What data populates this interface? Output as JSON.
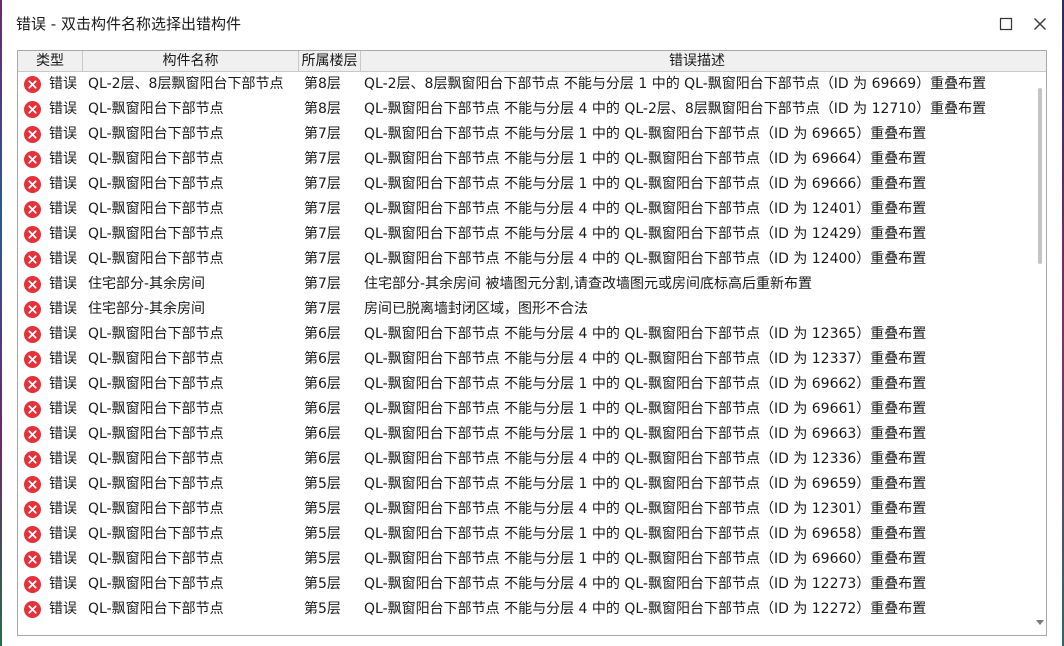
{
  "window": {
    "title": "错误 - 双击构件名称选择出错构件",
    "maximize_icon": "maximize-icon",
    "close_icon": "close-icon"
  },
  "table": {
    "columns": [
      "类型",
      "构件名称",
      "所属楼层",
      "错误描述"
    ],
    "rows": [
      {
        "type": "错误",
        "name": "QL-2层、8层飘窗阳台下部节点",
        "floor": "第8层",
        "desc": "QL-2层、8层飘窗阳台下部节点 不能与分层 1 中的 QL-飘窗阳台下部节点（ID 为 69669）重叠布置"
      },
      {
        "type": "错误",
        "name": "QL-飘窗阳台下部节点",
        "floor": "第8层",
        "desc": "QL-飘窗阳台下部节点 不能与分层 4 中的 QL-2层、8层飘窗阳台下部节点（ID 为 12710）重叠布置"
      },
      {
        "type": "错误",
        "name": "QL-飘窗阳台下部节点",
        "floor": "第7层",
        "desc": "QL-飘窗阳台下部节点 不能与分层 1 中的 QL-飘窗阳台下部节点（ID 为 69665）重叠布置"
      },
      {
        "type": "错误",
        "name": "QL-飘窗阳台下部节点",
        "floor": "第7层",
        "desc": "QL-飘窗阳台下部节点 不能与分层 1 中的 QL-飘窗阳台下部节点（ID 为 69664）重叠布置"
      },
      {
        "type": "错误",
        "name": "QL-飘窗阳台下部节点",
        "floor": "第7层",
        "desc": "QL-飘窗阳台下部节点 不能与分层 1 中的 QL-飘窗阳台下部节点（ID 为 69666）重叠布置"
      },
      {
        "type": "错误",
        "name": "QL-飘窗阳台下部节点",
        "floor": "第7层",
        "desc": "QL-飘窗阳台下部节点 不能与分层 4 中的 QL-飘窗阳台下部节点（ID 为 12401）重叠布置"
      },
      {
        "type": "错误",
        "name": "QL-飘窗阳台下部节点",
        "floor": "第7层",
        "desc": "QL-飘窗阳台下部节点 不能与分层 4 中的 QL-飘窗阳台下部节点（ID 为 12429）重叠布置"
      },
      {
        "type": "错误",
        "name": "QL-飘窗阳台下部节点",
        "floor": "第7层",
        "desc": "QL-飘窗阳台下部节点 不能与分层 4 中的 QL-飘窗阳台下部节点（ID 为 12400）重叠布置"
      },
      {
        "type": "错误",
        "name": "住宅部分-其余房间",
        "floor": "第7层",
        "desc": "住宅部分-其余房间 被墙图元分割,请查改墙图元或房间底标高后重新布置"
      },
      {
        "type": "错误",
        "name": "住宅部分-其余房间",
        "floor": "第7层",
        "desc": "房间已脱离墙封闭区域，图形不合法"
      },
      {
        "type": "错误",
        "name": "QL-飘窗阳台下部节点",
        "floor": "第6层",
        "desc": "QL-飘窗阳台下部节点 不能与分层 4 中的 QL-飘窗阳台下部节点（ID 为 12365）重叠布置"
      },
      {
        "type": "错误",
        "name": "QL-飘窗阳台下部节点",
        "floor": "第6层",
        "desc": "QL-飘窗阳台下部节点 不能与分层 4 中的 QL-飘窗阳台下部节点（ID 为 12337）重叠布置"
      },
      {
        "type": "错误",
        "name": "QL-飘窗阳台下部节点",
        "floor": "第6层",
        "desc": "QL-飘窗阳台下部节点 不能与分层 1 中的 QL-飘窗阳台下部节点（ID 为 69662）重叠布置"
      },
      {
        "type": "错误",
        "name": "QL-飘窗阳台下部节点",
        "floor": "第6层",
        "desc": "QL-飘窗阳台下部节点 不能与分层 1 中的 QL-飘窗阳台下部节点（ID 为 69661）重叠布置"
      },
      {
        "type": "错误",
        "name": "QL-飘窗阳台下部节点",
        "floor": "第6层",
        "desc": "QL-飘窗阳台下部节点 不能与分层 1 中的 QL-飘窗阳台下部节点（ID 为 69663）重叠布置"
      },
      {
        "type": "错误",
        "name": "QL-飘窗阳台下部节点",
        "floor": "第6层",
        "desc": "QL-飘窗阳台下部节点 不能与分层 4 中的 QL-飘窗阳台下部节点（ID 为 12336）重叠布置"
      },
      {
        "type": "错误",
        "name": "QL-飘窗阳台下部节点",
        "floor": "第5层",
        "desc": "QL-飘窗阳台下部节点 不能与分层 1 中的 QL-飘窗阳台下部节点（ID 为 69659）重叠布置"
      },
      {
        "type": "错误",
        "name": "QL-飘窗阳台下部节点",
        "floor": "第5层",
        "desc": "QL-飘窗阳台下部节点 不能与分层 4 中的 QL-飘窗阳台下部节点（ID 为 12301）重叠布置"
      },
      {
        "type": "错误",
        "name": "QL-飘窗阳台下部节点",
        "floor": "第5层",
        "desc": "QL-飘窗阳台下部节点 不能与分层 1 中的 QL-飘窗阳台下部节点（ID 为 69658）重叠布置"
      },
      {
        "type": "错误",
        "name": "QL-飘窗阳台下部节点",
        "floor": "第5层",
        "desc": "QL-飘窗阳台下部节点 不能与分层 1 中的 QL-飘窗阳台下部节点（ID 为 69660）重叠布置"
      },
      {
        "type": "错误",
        "name": "QL-飘窗阳台下部节点",
        "floor": "第5层",
        "desc": "QL-飘窗阳台下部节点 不能与分层 4 中的 QL-飘窗阳台下部节点（ID 为 12273）重叠布置"
      },
      {
        "type": "错误",
        "name": "QL-飘窗阳台下部节点",
        "floor": "第5层",
        "desc": "QL-飘窗阳台下部节点 不能与分层 4 中的 QL-飘窗阳台下部节点（ID 为 12272）重叠布置"
      }
    ],
    "row_icon": "error-icon",
    "error_color": "#e5323a"
  }
}
